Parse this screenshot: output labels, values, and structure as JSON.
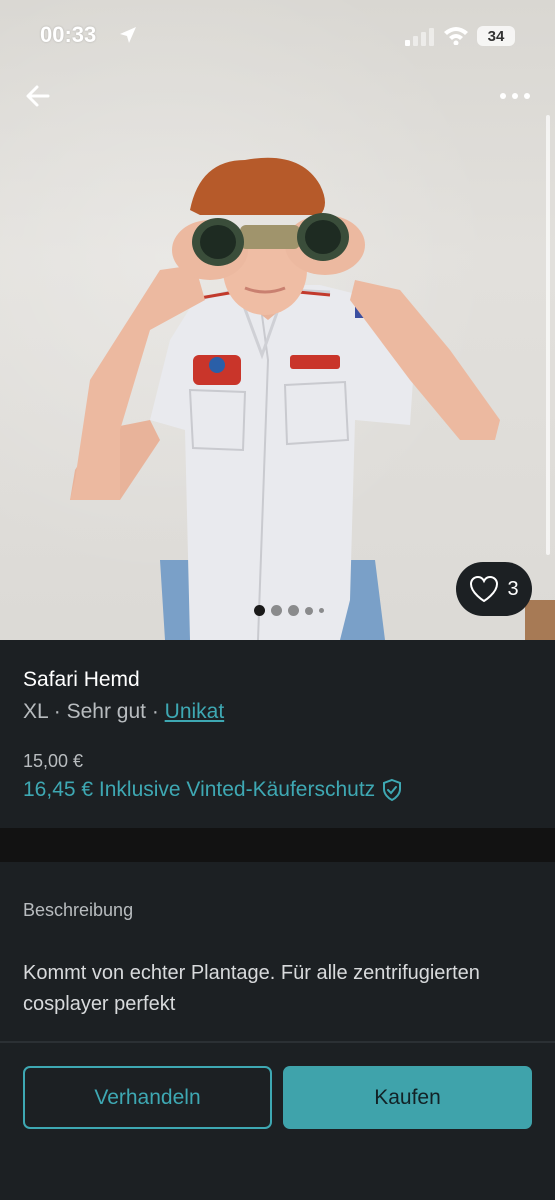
{
  "status_bar": {
    "time": "00:33",
    "battery": "34"
  },
  "product": {
    "title": "Safari Hemd",
    "size": "XL",
    "sep1": " · ",
    "condition": "Sehr gut",
    "sep2": " · ",
    "brand": "Unikat",
    "price": "15,00 €",
    "price_total": "16,45 € Inklusive Vinted-Käuferschutz",
    "favorites": "3"
  },
  "description": {
    "label": "Beschreibung",
    "text": "Kommt von echter Plantage. Für alle zentrifugierten cosplayer perfekt"
  },
  "actions": {
    "negotiate": "Verhandeln",
    "buy": "Kaufen"
  },
  "icons": {
    "back": "arrow-left-icon",
    "more": "more-horizontal-icon",
    "heart": "heart-icon",
    "shield": "shield-check-icon",
    "location": "location-arrow-icon",
    "signal": "signal-icon",
    "wifi": "wifi-icon"
  },
  "colors": {
    "accent": "#3ea8b3",
    "panel": "#1c2023",
    "background": "#121212"
  },
  "gallery": {
    "image_count": 5,
    "active_index": 0
  }
}
